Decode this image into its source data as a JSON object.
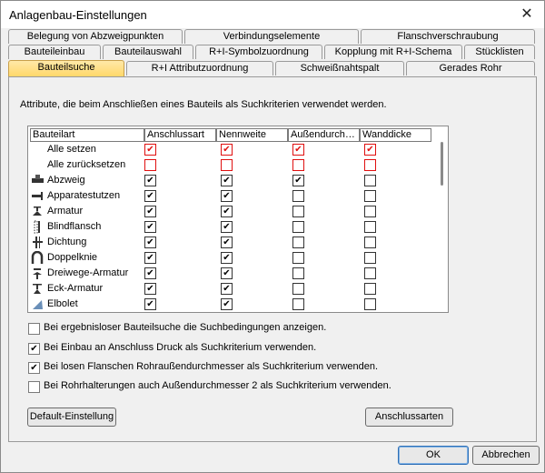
{
  "window": {
    "title": "Anlagenbau-Einstellungen",
    "close_glyph": "✕"
  },
  "tabs": {
    "row1": [
      "Belegung von Abzweigpunkten",
      "Verbindungselemente",
      "Flanschverschraubung"
    ],
    "row2": [
      "Bauteileinbau",
      "Bauteilauswahl",
      "R+I-Symbolzuordnung",
      "Kopplung mit R+I-Schema",
      "Stücklisten"
    ],
    "row3": [
      "Bauteilsuche",
      "R+I Attributzuordnung",
      "Schweißnahtspalt",
      "Gerades Rohr"
    ],
    "active": "Bauteilsuche"
  },
  "description": "Attribute, die beim Anschließen eines Bauteils als Suchkriterien verwendet werden.",
  "table": {
    "columns": [
      "Bauteilart",
      "Anschlussart",
      "Nennweite",
      "Außendurch…",
      "Wanddicke"
    ],
    "rows": [
      {
        "label": "Alle setzen",
        "icon": "",
        "checks": [
          true,
          true,
          true,
          true
        ],
        "red": true
      },
      {
        "label": "Alle zurücksetzen",
        "icon": "",
        "checks": [
          false,
          false,
          false,
          false
        ],
        "red": true
      },
      {
        "label": "Abzweig",
        "icon": "tee-branch-icon",
        "checks": [
          true,
          true,
          true,
          false
        ],
        "red": false
      },
      {
        "label": "Apparatestutzen",
        "icon": "nozzle-icon",
        "checks": [
          true,
          true,
          false,
          false
        ],
        "red": false
      },
      {
        "label": "Armatur",
        "icon": "valve-icon",
        "checks": [
          true,
          true,
          false,
          false
        ],
        "red": false
      },
      {
        "label": "Blindflansch",
        "icon": "blind-flange-icon",
        "checks": [
          true,
          true,
          false,
          false
        ],
        "red": false
      },
      {
        "label": "Dichtung",
        "icon": "gasket-icon",
        "checks": [
          true,
          true,
          false,
          false
        ],
        "red": false
      },
      {
        "label": "Doppelknie",
        "icon": "double-elbow-icon",
        "checks": [
          true,
          true,
          false,
          false
        ],
        "red": false
      },
      {
        "label": "Dreiwege-Armatur",
        "icon": "three-way-valve-icon",
        "checks": [
          true,
          true,
          false,
          false
        ],
        "red": false
      },
      {
        "label": "Eck-Armatur",
        "icon": "angle-valve-icon",
        "checks": [
          true,
          true,
          false,
          false
        ],
        "red": false
      },
      {
        "label": "Elbolet",
        "icon": "elbolet-icon",
        "checks": [
          true,
          true,
          false,
          false
        ],
        "red": false
      }
    ]
  },
  "options": [
    {
      "label": "Bei ergebnisloser Bauteilsuche die Suchbedingungen anzeigen.",
      "checked": false
    },
    {
      "label": "Bei Einbau an Anschluss Druck als Suchkriterium verwenden.",
      "checked": true
    },
    {
      "label": "Bei losen Flanschen Rohraußendurchmesser als Suchkriterium verwenden.",
      "checked": true
    },
    {
      "label": "Bei Rohrhalterungen auch Außendurchmesser 2 als Suchkriterium verwenden.",
      "checked": false
    }
  ],
  "buttons": {
    "default": "Default-Einstellung",
    "connection_types": "Anschlussarten",
    "ok": "OK",
    "cancel": "Abbrechen"
  },
  "colors": {
    "active_tab": "#ffd86a",
    "red_check": "#e01010"
  }
}
